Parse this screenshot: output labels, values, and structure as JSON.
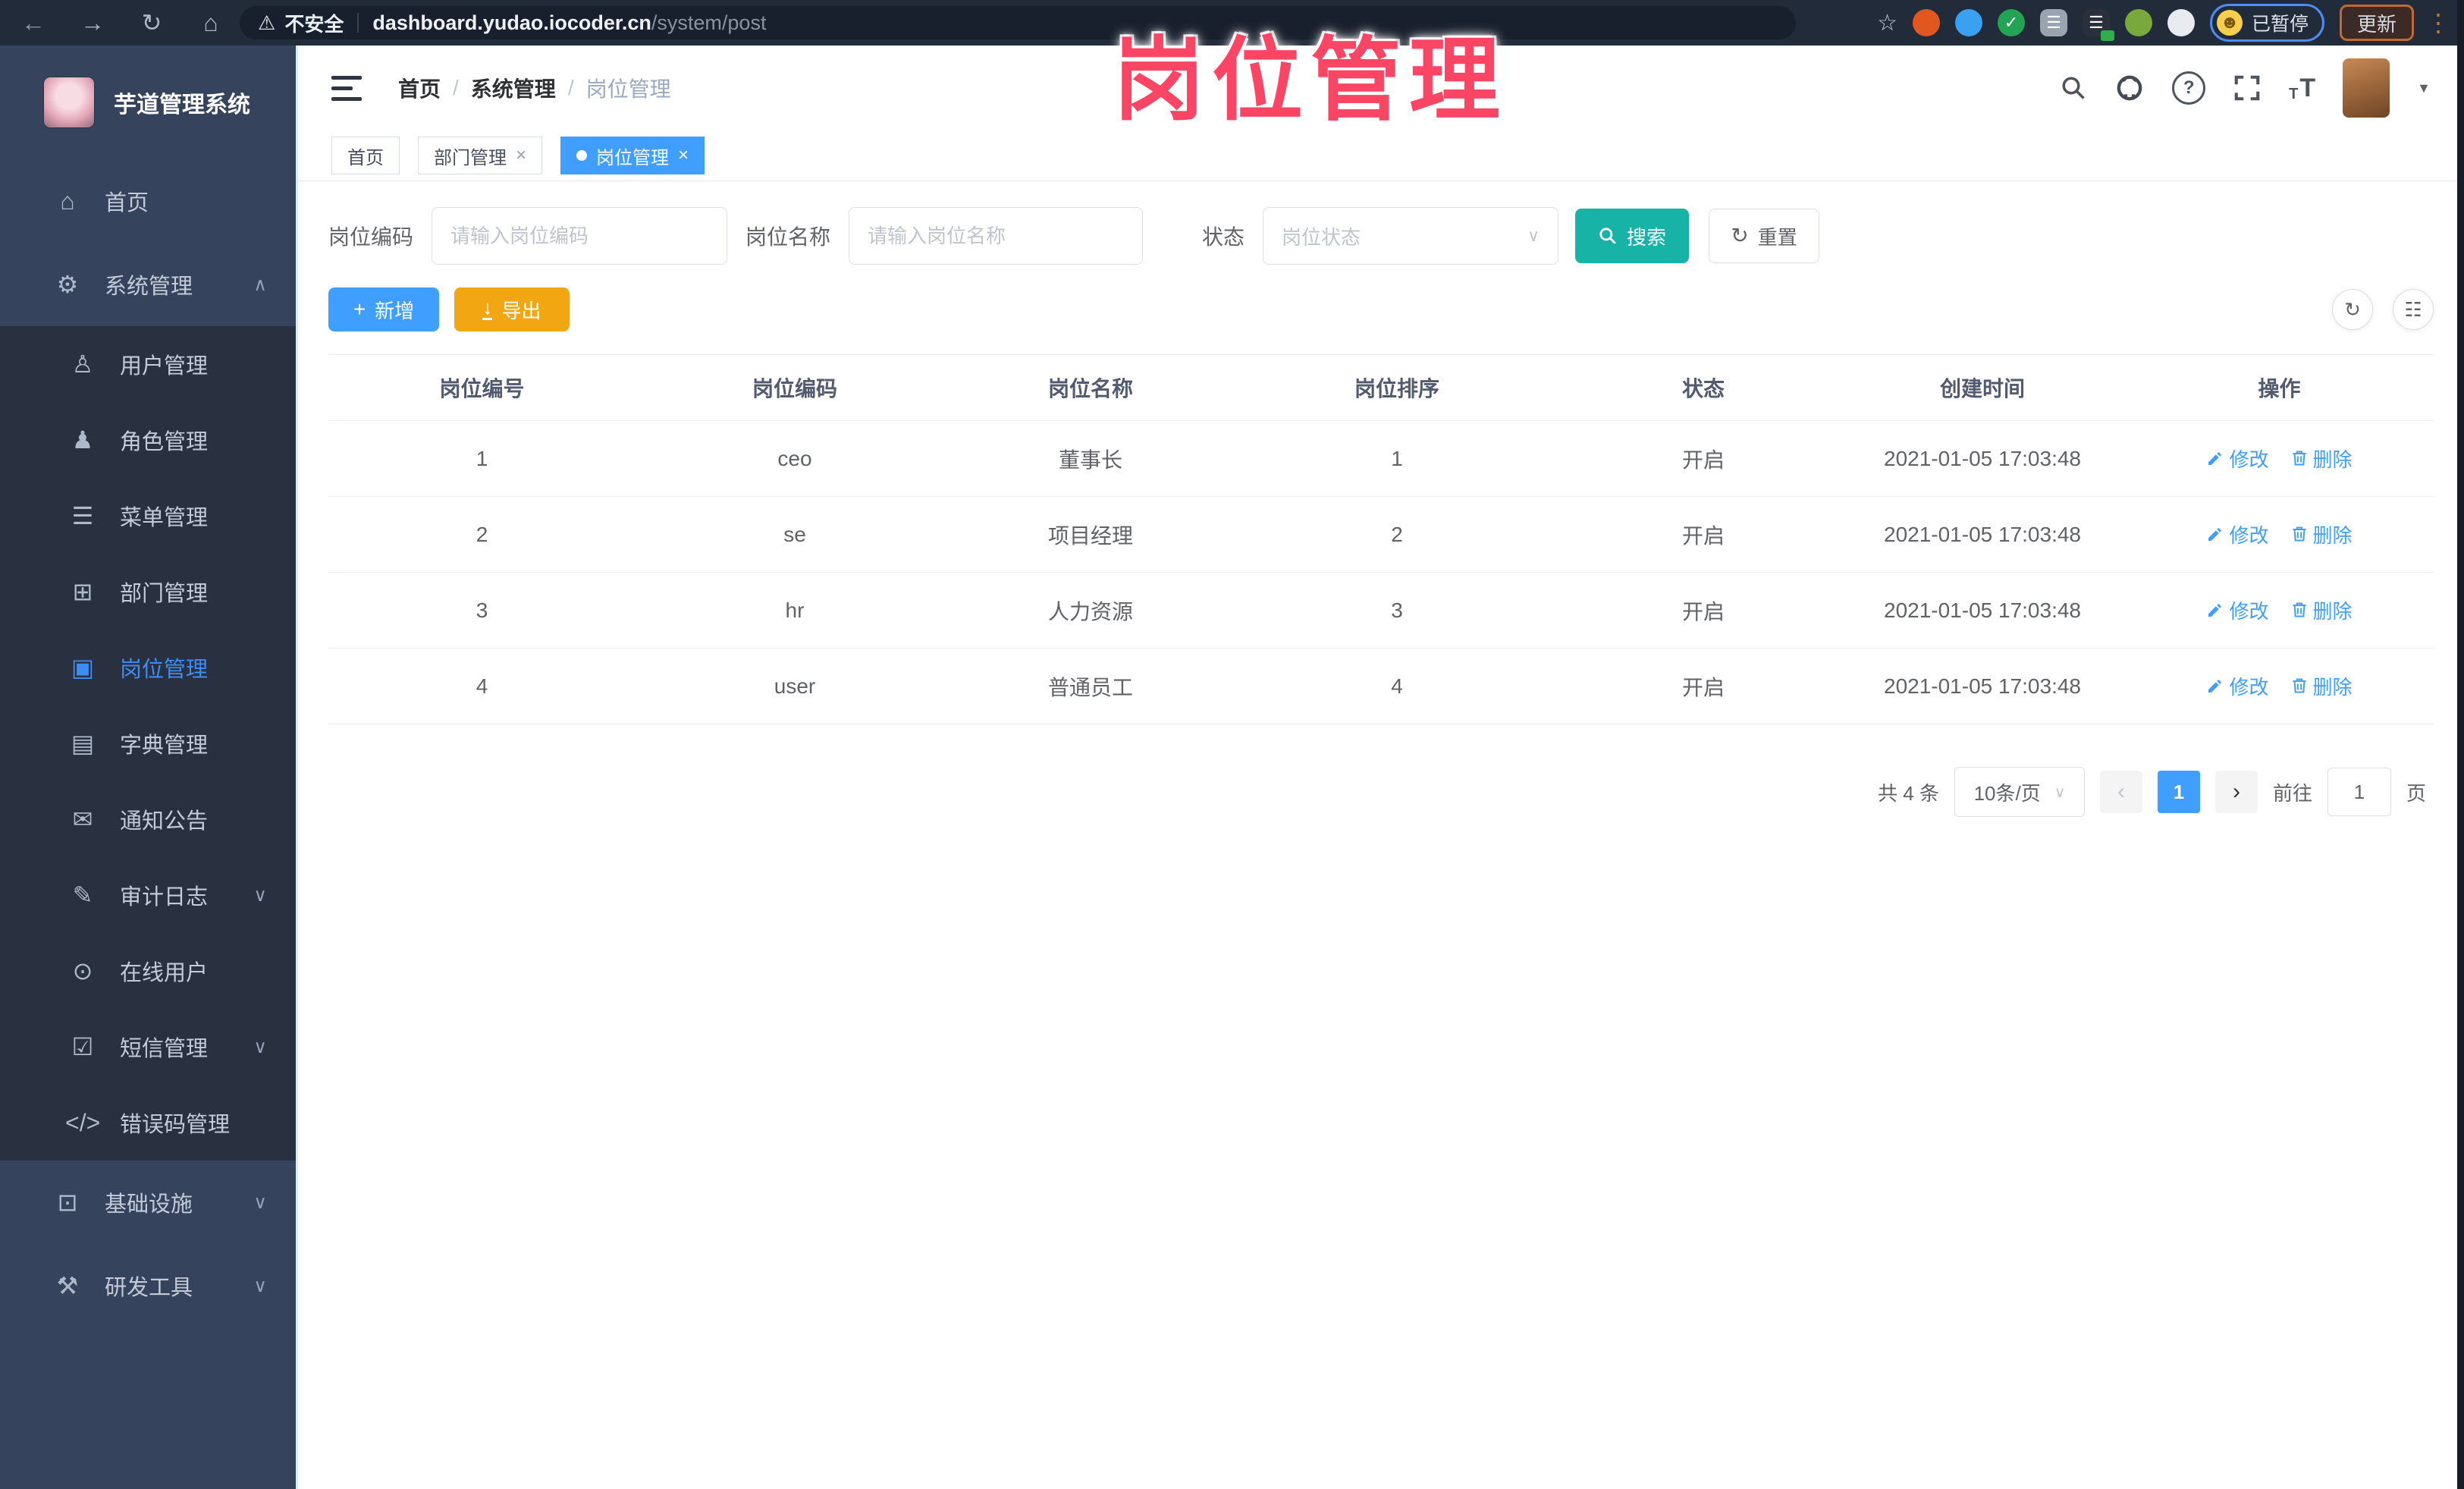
{
  "browser": {
    "security_label": "不安全",
    "url_host": "dashboard.yudao.iocoder.cn",
    "url_path": "/system/post",
    "profile_status": "已暂停",
    "update_label": "更新",
    "nav_icons": [
      "back-icon",
      "forward-icon",
      "reload-icon",
      "home-icon"
    ],
    "extensions": [
      {
        "name": "bookmark-star-icon",
        "glyph": "☆"
      },
      {
        "name": "extension-orange-ring-icon",
        "bg": "#e2571f",
        "shape": "circle",
        "glyph": ""
      },
      {
        "name": "extension-location-pin-icon",
        "bg": "#3aa0f2",
        "shape": "circle",
        "glyph": ""
      },
      {
        "name": "extension-green-check-icon",
        "bg": "#23a455",
        "shape": "circle",
        "glyph": "✓"
      },
      {
        "name": "extension-sliders-icon",
        "bg": "#9aa3b0",
        "glyph": "☰"
      },
      {
        "name": "extension-list-badge-icon",
        "bg": "#2a313d",
        "glyph": "☰",
        "badge": true
      },
      {
        "name": "extension-leaf-icon",
        "bg": "#79a93c",
        "shape": "circle",
        "glyph": ""
      },
      {
        "name": "extension-puzzle-icon",
        "bg": "#e8ebf0",
        "shape": "circle",
        "glyph": ""
      }
    ]
  },
  "overlay_title": "岗位管理",
  "sidebar": {
    "logo_title": "芋道管理系统",
    "items": [
      {
        "label": "首页",
        "icon": "home-icon",
        "glyph": "⌂",
        "level": 1
      },
      {
        "label": "系统管理",
        "icon": "gear-icon",
        "glyph": "⚙",
        "level": 1,
        "chevron": "up"
      },
      {
        "label": "用户管理",
        "icon": "user-icon",
        "glyph": "♙",
        "level": 2
      },
      {
        "label": "角色管理",
        "icon": "roles-icon",
        "glyph": "♟",
        "level": 2
      },
      {
        "label": "菜单管理",
        "icon": "menu-list-icon",
        "glyph": "☰",
        "level": 2
      },
      {
        "label": "部门管理",
        "icon": "department-tree-icon",
        "glyph": "⊞",
        "level": 2
      },
      {
        "label": "岗位管理",
        "icon": "post-badge-icon",
        "glyph": "▣",
        "level": 2,
        "active": true
      },
      {
        "label": "字典管理",
        "icon": "dictionary-icon",
        "glyph": "▤",
        "level": 2
      },
      {
        "label": "通知公告",
        "icon": "announcement-icon",
        "glyph": "✉",
        "level": 2
      },
      {
        "label": "审计日志",
        "icon": "audit-log-icon",
        "glyph": "✎",
        "level": 2,
        "chevron": "down"
      },
      {
        "label": "在线用户",
        "icon": "online-users-icon",
        "glyph": "⊙",
        "level": 2
      },
      {
        "label": "短信管理",
        "icon": "sms-shield-icon",
        "glyph": "☑",
        "level": 2,
        "chevron": "down"
      },
      {
        "label": "错误码管理",
        "icon": "error-code-icon",
        "glyph": "</>",
        "level": 2
      },
      {
        "label": "基础设施",
        "icon": "infrastructure-icon",
        "glyph": "⊡",
        "level": 1,
        "chevron": "down"
      },
      {
        "label": "研发工具",
        "icon": "dev-tools-icon",
        "glyph": "⚒",
        "level": 1,
        "chevron": "down"
      }
    ]
  },
  "header": {
    "breadcrumbs": [
      "首页",
      "系统管理",
      "岗位管理"
    ],
    "icons": [
      "search-icon",
      "github-icon",
      "question-icon",
      "fullscreen-icon",
      "font-size-icon",
      "avatar",
      "chevron-down-icon"
    ]
  },
  "tabs": [
    {
      "label": "首页",
      "closable": false,
      "active": false
    },
    {
      "label": "部门管理",
      "closable": true,
      "active": false
    },
    {
      "label": "岗位管理",
      "closable": true,
      "active": true
    }
  ],
  "filters": {
    "code_label": "岗位编码",
    "code_placeholder": "请输入岗位编码",
    "name_label": "岗位名称",
    "name_placeholder": "请输入岗位名称",
    "status_label": "状态",
    "status_placeholder": "岗位状态",
    "search_label": "搜索",
    "reset_label": "重置"
  },
  "toolbar": {
    "add_label": "新增",
    "export_label": "导出"
  },
  "table": {
    "columns": [
      "岗位编号",
      "岗位编码",
      "岗位名称",
      "岗位排序",
      "状态",
      "创建时间",
      "操作"
    ],
    "rows": [
      {
        "id": "1",
        "code": "ceo",
        "name": "董事长",
        "sort": "1",
        "status": "开启",
        "created": "2021-01-05 17:03:48"
      },
      {
        "id": "2",
        "code": "se",
        "name": "项目经理",
        "sort": "2",
        "status": "开启",
        "created": "2021-01-05 17:03:48"
      },
      {
        "id": "3",
        "code": "hr",
        "name": "人力资源",
        "sort": "3",
        "status": "开启",
        "created": "2021-01-05 17:03:48"
      },
      {
        "id": "4",
        "code": "user",
        "name": "普通员工",
        "sort": "4",
        "status": "开启",
        "created": "2021-01-05 17:03:48"
      }
    ],
    "edit_label": "修改",
    "delete_label": "删除"
  },
  "pagination": {
    "total_text": "共 4 条",
    "page_size": "10条/页",
    "current_page": "1",
    "goto_label": "前往",
    "goto_value": "1",
    "page_unit": "页"
  },
  "colors": {
    "accent_blue": "#409eff",
    "search_teal": "#17b3a6",
    "export_orange": "#f2a712",
    "overlay_pink": "#fb4565",
    "sidebar_navy": "#36435c",
    "submenu_dark": "#29303f"
  }
}
